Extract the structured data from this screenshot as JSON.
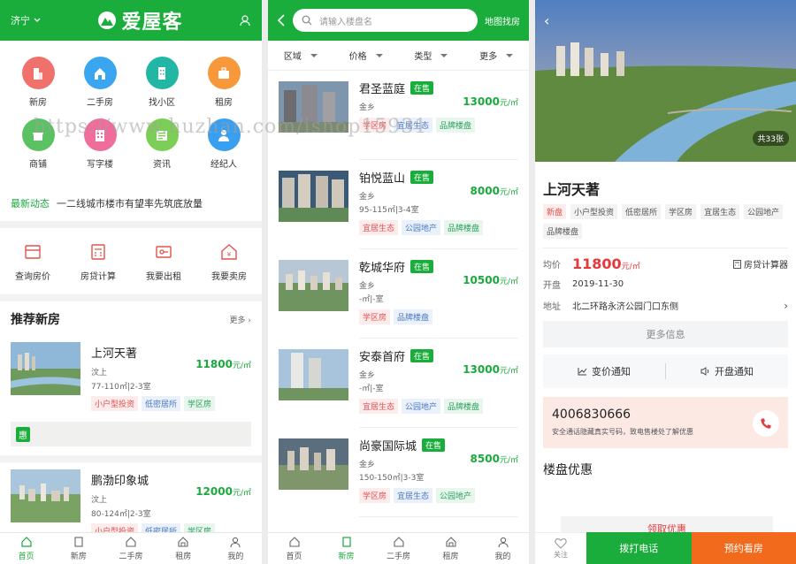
{
  "home": {
    "city": "济宁",
    "brand": "爱屋客",
    "categories": [
      {
        "label": "新房",
        "color": "#f0716b",
        "icon": "building-icon"
      },
      {
        "label": "二手房",
        "color": "#3aa6f0",
        "icon": "house-icon"
      },
      {
        "label": "找小区",
        "color": "#21b7a4",
        "icon": "apartment-icon"
      },
      {
        "label": "租房",
        "color": "#f7993b",
        "icon": "briefcase-icon"
      },
      {
        "label": "商铺",
        "color": "#5bc263",
        "icon": "shop-icon"
      },
      {
        "label": "写字楼",
        "color": "#ef6d9b",
        "icon": "office-icon"
      },
      {
        "label": "资讯",
        "color": "#7ccf56",
        "icon": "news-icon"
      },
      {
        "label": "经纪人",
        "color": "#3b9ff0",
        "icon": "agent-icon"
      }
    ],
    "news_label": "最新动态",
    "news_text": "一二线城市楼市有望率先筑底放量",
    "tools": [
      "查询房价",
      "房贷计算",
      "我要出租",
      "我要卖房"
    ],
    "section_title": "推荐新房",
    "section_more": "更多",
    "houses": [
      {
        "name": "上河天著",
        "district": "汶上",
        "area": "77-110㎡|2-3室",
        "price": "11800",
        "unit": "元/㎡",
        "tags": [
          "小户型投资",
          "低密居所",
          "学区房"
        ]
      },
      {
        "name": "鹏渤印象城",
        "district": "汶上",
        "area": "80-124㎡|2-3室",
        "price": "12000",
        "unit": "元/㎡",
        "tags": [
          "小户型投资",
          "低密居所",
          "学区房"
        ]
      }
    ],
    "promo_badge": "惠",
    "tabs": [
      "首页",
      "新房",
      "二手房",
      "租房",
      "我的"
    ]
  },
  "list": {
    "search_placeholder": "请输入楼盘名",
    "map_link": "地图找房",
    "filters": [
      "区域",
      "价格",
      "类型",
      "更多"
    ],
    "status": "在售",
    "items": [
      {
        "name": "君圣蓝庭",
        "district": "金乡",
        "area": "",
        "price": "13000",
        "unit": "元/㎡",
        "tags": [
          "学区房",
          "宜居生态",
          "品牌楼盘"
        ],
        "tag_colors": [
          "r",
          "b",
          "g"
        ]
      },
      {
        "name": "铂悦蓝山",
        "district": "金乡",
        "area": "95-115㎡|3-4室",
        "price": "8000",
        "unit": "元/㎡",
        "tags": [
          "宜居生态",
          "公园地产",
          "品牌楼盘"
        ],
        "tag_colors": [
          "r",
          "b",
          "g"
        ]
      },
      {
        "name": "乾城华府",
        "district": "金乡",
        "area": "-㎡|-室",
        "price": "10500",
        "unit": "元/㎡",
        "tags": [
          "学区房",
          "品牌楼盘"
        ],
        "tag_colors": [
          "r",
          "b"
        ]
      },
      {
        "name": "安泰首府",
        "district": "金乡",
        "area": "-㎡|-室",
        "price": "13000",
        "unit": "元/㎡",
        "tags": [
          "宜居生态",
          "公园地产",
          "品牌楼盘"
        ],
        "tag_colors": [
          "r",
          "b",
          "g"
        ]
      },
      {
        "name": "尚豪国际城",
        "district": "金乡",
        "area": "150-150㎡|3-3室",
        "price": "8500",
        "unit": "元/㎡",
        "tags": [
          "学区房",
          "宜居生态",
          "公园地产"
        ],
        "tag_colors": [
          "r",
          "b",
          "g"
        ]
      }
    ],
    "tabs": [
      "首页",
      "新房",
      "二手房",
      "租房",
      "我的"
    ]
  },
  "detail": {
    "photo_count": "共33张",
    "title": "上河天著",
    "tags": [
      "新盘",
      "小户型投资",
      "低密居所",
      "学区房",
      "宜居生态",
      "公园地产",
      "品牌楼盘"
    ],
    "price_label": "均价",
    "price": "11800",
    "price_unit": "元/㎡",
    "calculator": "房贷计算器",
    "open_label": "开盘",
    "open_date": "2019-11-30",
    "addr_label": "地址",
    "address": "北二环路永济公园门口东侧",
    "more_info": "更多信息",
    "price_notify": "变价通知",
    "open_notify": "开盘通知",
    "phone": "4006830666",
    "phone_desc": "安全通话隐藏真实号码，致电售楼处了解优惠",
    "offers_title": "楼盘优惠",
    "coupon_peek": "领取优惠",
    "fav": "关注",
    "call": "拨打电话",
    "book": "预约看房"
  },
  "watermark": "https://www.huzhan.com/ishop15931"
}
